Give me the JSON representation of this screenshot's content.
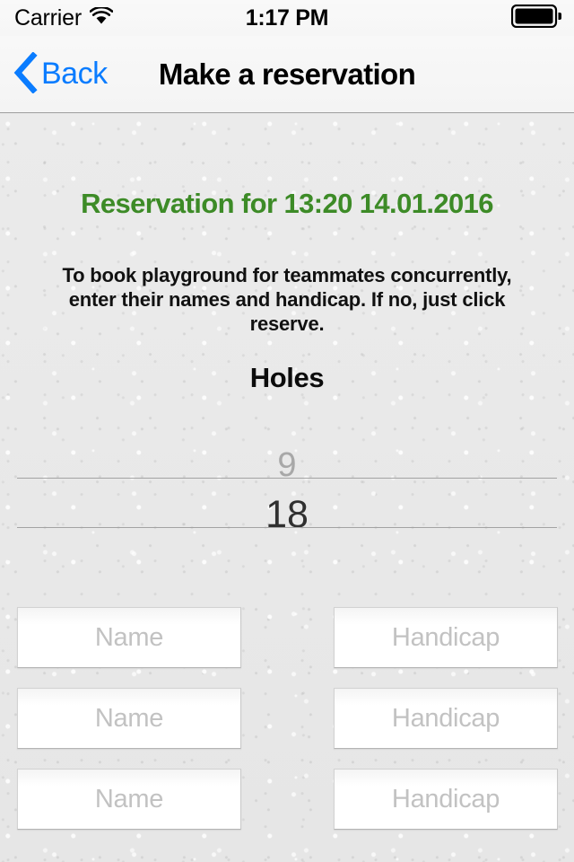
{
  "status_bar": {
    "carrier": "Carrier",
    "wifi_icon": "wifi-icon",
    "time": "1:17 PM",
    "battery_icon": "battery-full-icon"
  },
  "nav_bar": {
    "back_label": "Back",
    "back_icon": "chevron-left-icon",
    "title": "Make a reservation",
    "accent_color": "#0a7cff"
  },
  "content": {
    "reservation_heading": "Reservation for 13:20 14.01.2016",
    "heading_color": "#3d8b27",
    "instructions": "To book playground for teammates concurrently, enter their names and handicap. If no, just click reserve.",
    "holes_label": "Holes"
  },
  "holes_picker": {
    "options": [
      "9",
      "18"
    ],
    "previous_visible": "9",
    "selected": "18"
  },
  "teammate_fields": {
    "name_placeholder": "Name",
    "handicap_placeholder": "Handicap",
    "rows": [
      {
        "name_value": "",
        "handicap_value": ""
      },
      {
        "name_value": "",
        "handicap_value": ""
      },
      {
        "name_value": "",
        "handicap_value": ""
      }
    ]
  }
}
